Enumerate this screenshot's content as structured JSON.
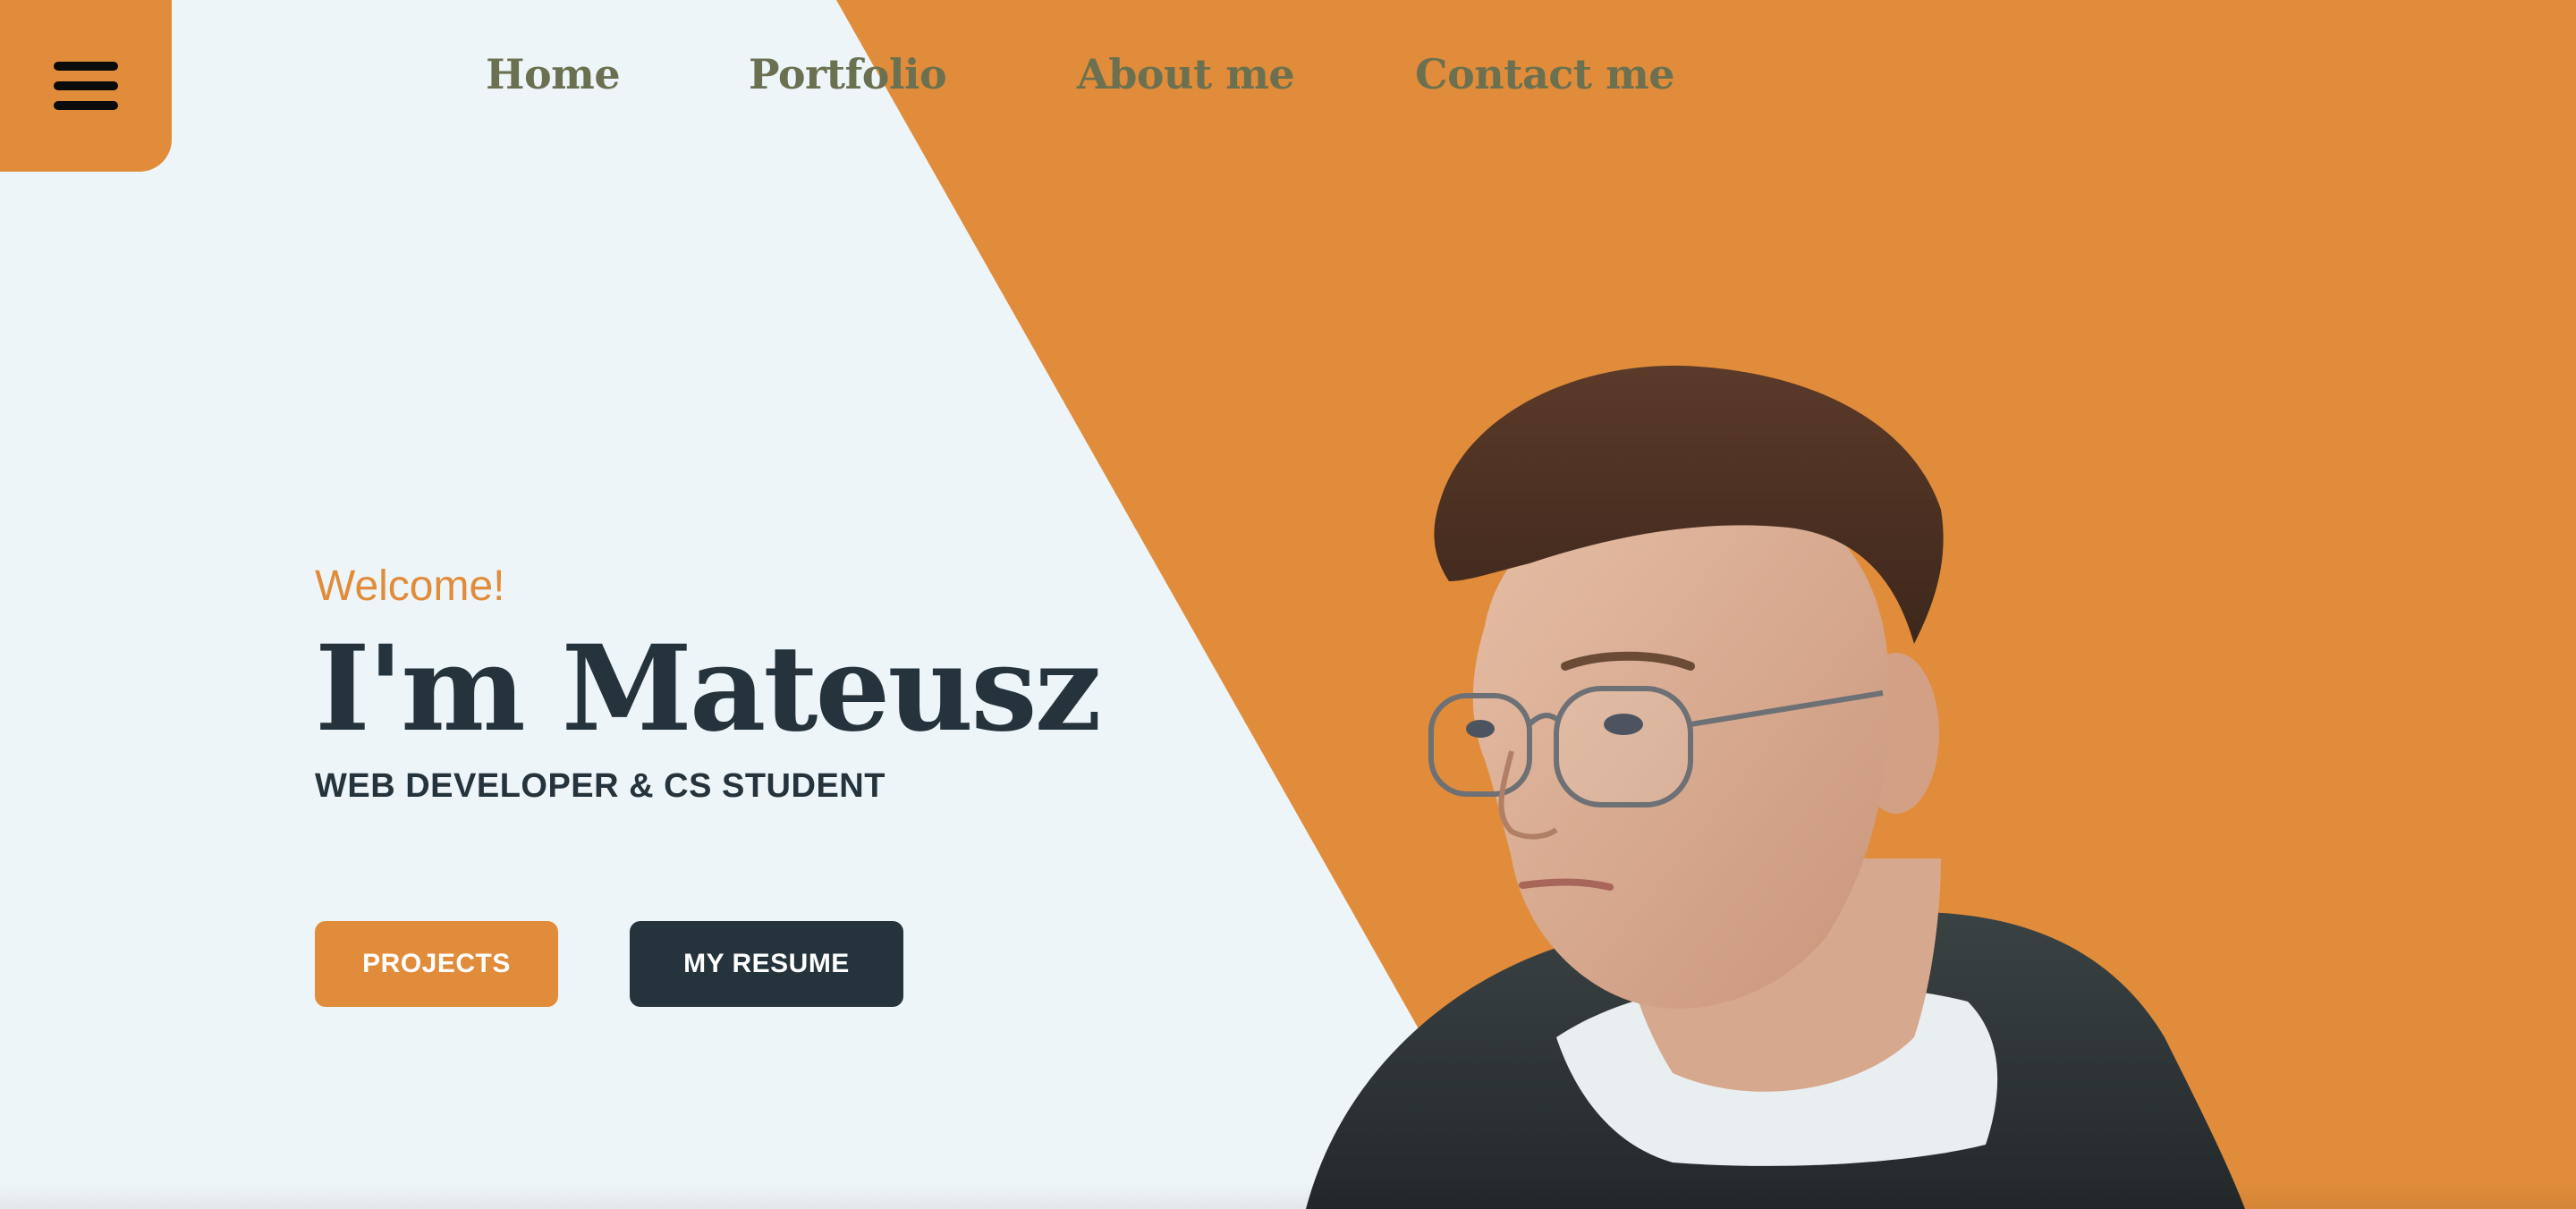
{
  "nav": {
    "items": [
      {
        "label": "Home"
      },
      {
        "label": "Portfolio"
      },
      {
        "label": "About me"
      },
      {
        "label": "Contact me"
      }
    ]
  },
  "hero": {
    "greeting": "Welcome!",
    "name": "I'm Mateusz",
    "subtitle": "WEB DEVELOPER & CS STUDENT",
    "buttons": {
      "projects": "PROJECTS",
      "resume": "MY RESUME"
    }
  },
  "icons": {
    "menu": "hamburger-icon"
  },
  "colors": {
    "accent": "#e08c3a",
    "dark": "#24333c",
    "nav_text": "#6b7150",
    "background": "#eef5f9"
  }
}
